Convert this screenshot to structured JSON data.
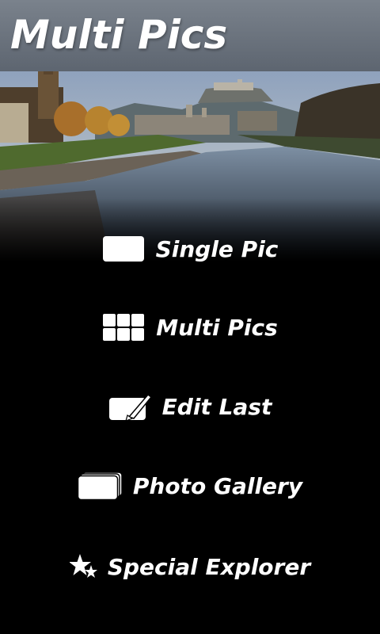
{
  "app": {
    "title": "Multi Pics"
  },
  "menu": {
    "items": [
      {
        "label": "Single Pic",
        "icon": "single-frame-icon"
      },
      {
        "label": "Multi Pics",
        "icon": "grid-icon"
      },
      {
        "label": "Edit Last",
        "icon": "edit-brush-icon"
      },
      {
        "label": "Photo Gallery",
        "icon": "stacked-photos-icon"
      },
      {
        "label": "Special Explorer",
        "icon": "stars-icon"
      }
    ]
  },
  "colors": {
    "header": "#6b737d",
    "background": "#000000",
    "text": "#ffffff"
  }
}
